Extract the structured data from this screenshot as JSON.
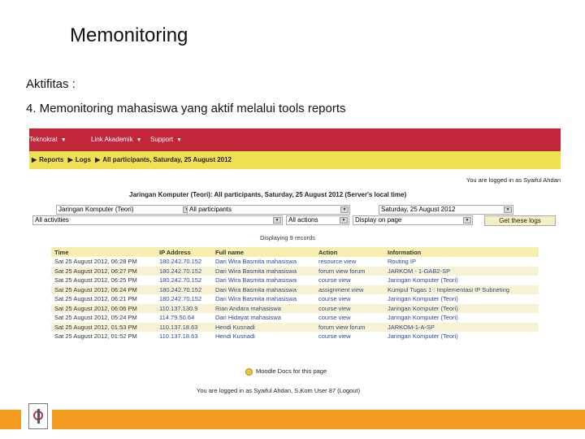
{
  "slide": {
    "title": "Memonitoring",
    "line1": "Aktifitas :",
    "line2": "4. Memonitoring mahasiswa yang aktif melalui tools reports"
  },
  "menu": {
    "items": [
      "Teknokrat",
      "Link Akademik",
      "Support"
    ]
  },
  "breadcrumb": {
    "items": [
      "Reports",
      "Logs",
      "All participants, Saturday, 25 August 2012"
    ]
  },
  "logged_top": "You are logged in as Syaiful Ahdan",
  "report_heading": "Jaringan Komputer (Teori): All participants, Saturday, 25 August 2012 (Server's local time)",
  "filters": {
    "course": "Jaringan Komputer (Teori)",
    "participants": "All participants",
    "date": "Saturday, 25 August 2012",
    "activities": "All activities",
    "actions": "All actions",
    "display": "Display on page",
    "button": "Get these logs"
  },
  "displaying": "Displaying 9 records",
  "table": {
    "headers": [
      "Time",
      "IP Address",
      "Full name",
      "Action",
      "Information"
    ],
    "rows": [
      [
        "Sat 25 August 2012, 06:28 PM",
        "180.242.70.152",
        "Dari Wira Basmita mahasiswa",
        "resource view",
        "Routing IP"
      ],
      [
        "Sat 25 August 2012, 06:27 PM",
        "180.242.70.152",
        "Dari Wira Basmita mahasiswa",
        "forum view forum",
        "JARKOM - 1-GAB2-SP"
      ],
      [
        "Sat 25 August 2012, 06:25 PM",
        "180.242.70.152",
        "Dari Wira Basmita mahasiswa",
        "course view",
        "Jaringan Komputer (Teori)"
      ],
      [
        "Sat 25 August 2012, 06:24 PM",
        "180.242.70.152",
        "Dari Wira Basmita mahasiswa",
        "assignment view",
        "Kumpul Tugas 1 : Implementasi IP Subneting"
      ],
      [
        "Sat 25 August 2012, 06:21 PM",
        "180.242.70.152",
        "Dari Wira Basmita mahasiswa",
        "course view",
        "Jaringan Komputer (Teori)"
      ],
      [
        "Sat 25 August 2012, 06:06 PM",
        "110.137.130.9",
        "Rian Andara mahasiswa",
        "course view",
        "Jaringan Komputer (Teori)"
      ],
      [
        "Sat 25 August 2012, 05:24 PM",
        "114.79.50.64",
        "Dari Hidayat mahasiswa",
        "course view",
        "Jaringan Komputer (Teori)"
      ],
      [
        "Sat 25 August 2012, 01:53 PM",
        "110.137.18.63",
        "Hendi Kusnadi",
        "forum view forum",
        "JARKOM-1-A-SP"
      ],
      [
        "Sat 25 August 2012, 01:52 PM",
        "110.137.18.63",
        "Hendi Kusnadi",
        "course view",
        "Jaringan Komputer (Teori)"
      ]
    ]
  },
  "docs_link": "Moodle Docs for this page",
  "logged_bottom": "You are logged in as Syaiful Ahdan, S.Kom User 87 (Logout)"
}
